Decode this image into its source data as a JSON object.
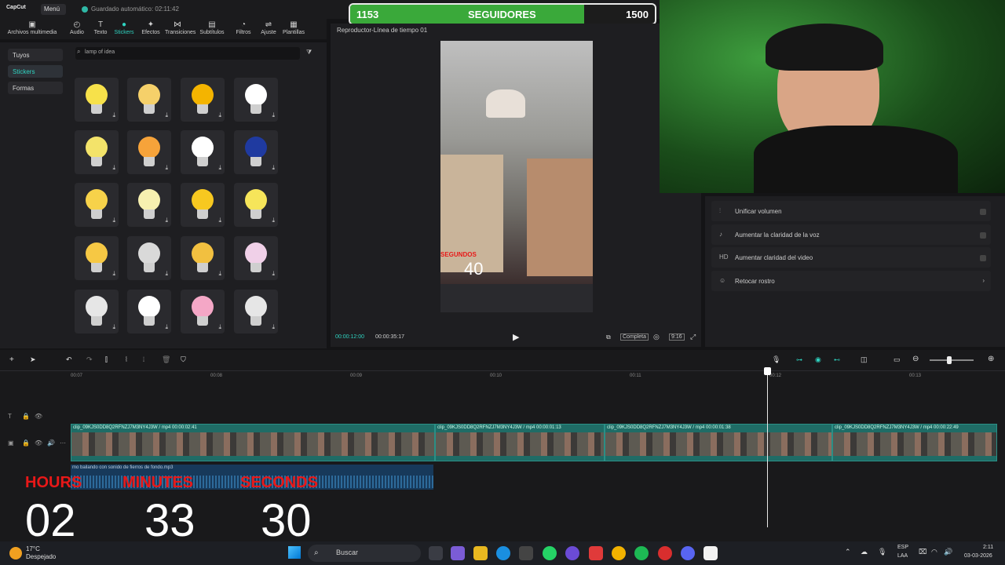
{
  "app": {
    "logo": "CapCut",
    "menu_label": "Menú",
    "autosave": "Guardado automático: 02:11:42"
  },
  "followers": {
    "current": 1153,
    "label": "SEGUIDORES",
    "goal": 1500
  },
  "tools": [
    {
      "label": "Archivos multimedia",
      "icon": "media-icon"
    },
    {
      "label": "Audio",
      "icon": "audio-icon"
    },
    {
      "label": "Texto",
      "icon": "text-icon"
    },
    {
      "label": "Stickers",
      "icon": "sticker-icon",
      "active": true
    },
    {
      "label": "Efectos",
      "icon": "effects-icon"
    },
    {
      "label": "Transiciones",
      "icon": "transitions-icon"
    },
    {
      "label": "Subtítulos",
      "icon": "subtitles-icon"
    },
    {
      "label": "Filtros",
      "icon": "filters-icon"
    },
    {
      "label": "Ajuste",
      "icon": "adjust-icon"
    },
    {
      "label": "Plantillas",
      "icon": "templates-icon"
    }
  ],
  "leftnav": [
    "Tuyos",
    "Stickers",
    "Formas"
  ],
  "search": {
    "value": "lamp of idea"
  },
  "player": {
    "title": "Reproductor-Línea de tiempo 01",
    "current_time": "00:00:12:00",
    "total_time": "00:00:35:17",
    "quality": "Completa",
    "ratio": "9:16"
  },
  "video_overlay": {
    "label": "SEGUNDOS",
    "value": "40"
  },
  "right_panel": [
    {
      "label": "Unificar volumen",
      "icon": "volume-icon",
      "control": "toggle"
    },
    {
      "label": "Aumentar la claridad de la voz",
      "icon": "voice-icon",
      "control": "toggle"
    },
    {
      "label": "Aumentar claridad del video",
      "icon": "hd-icon",
      "control": "toggle"
    },
    {
      "label": "Retocar rostro",
      "icon": "face-icon",
      "control": "chevron"
    }
  ],
  "ruler": [
    "00:07",
    "00:08",
    "00:09",
    "00:10",
    "00:11",
    "00:12",
    "00:13"
  ],
  "clips": [
    {
      "label": "clip_09KJS0DD8Q2RFNZJ7M3NY4J3W / mp4   00:00:02:41"
    },
    {
      "label": "clip_09KJS0DD8Q2RFNZJ7M3NY4J3W / mp4   00:00:01:13"
    },
    {
      "label": "clip_09KJS0DD8Q2RFNZJ7M3NY4J3W / mp4   00:00:01:38"
    },
    {
      "label": "clip_09KJS0DD8Q2RFNZJ7M3NY4J3W / mp4   00:00:22:49"
    }
  ],
  "audio_clip": {
    "label": "mo bailando con sonido de fierros de fondo.mp3"
  },
  "countdown": {
    "hours_label": "HOURS",
    "minutes_label": "MINUTES",
    "seconds_label": "SECONDS",
    "hours": "02",
    "minutes": "33",
    "seconds": "30"
  },
  "taskbar": {
    "weather_temp": "17°C",
    "weather_desc": "Despejado",
    "search": "Buscar",
    "lang": "ESP",
    "lang2": "LAA",
    "time": "2:11",
    "date": "03-03-2026"
  }
}
